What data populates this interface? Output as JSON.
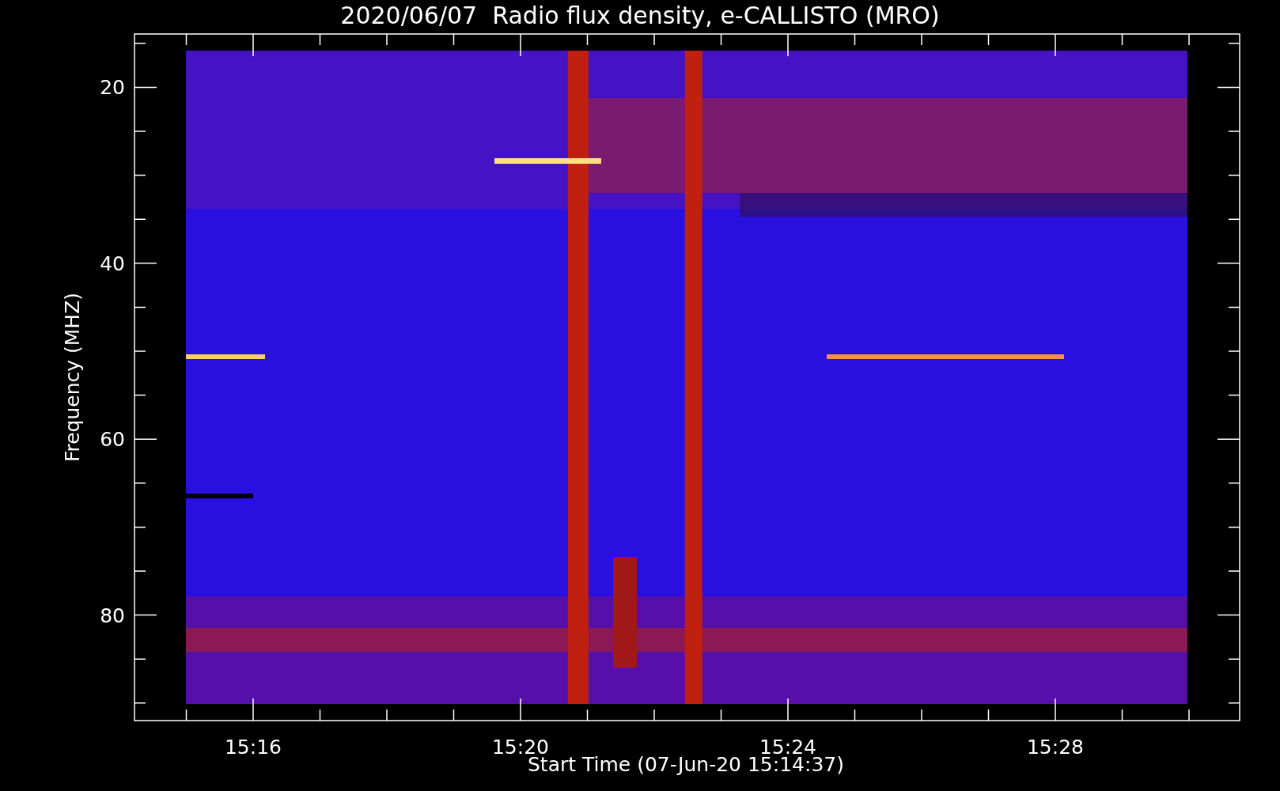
{
  "title": "2020/06/07  Radio flux density, e-CALLISTO (MRO)",
  "ylabel": "Frequency (MHZ)",
  "xlabel": "Start Time (07-Jun-20 15:14:37)",
  "yticks": [
    "20",
    "40",
    "60",
    "80"
  ],
  "xticks": [
    "15:16",
    "15:20",
    "15:24",
    "15:28"
  ]
}
